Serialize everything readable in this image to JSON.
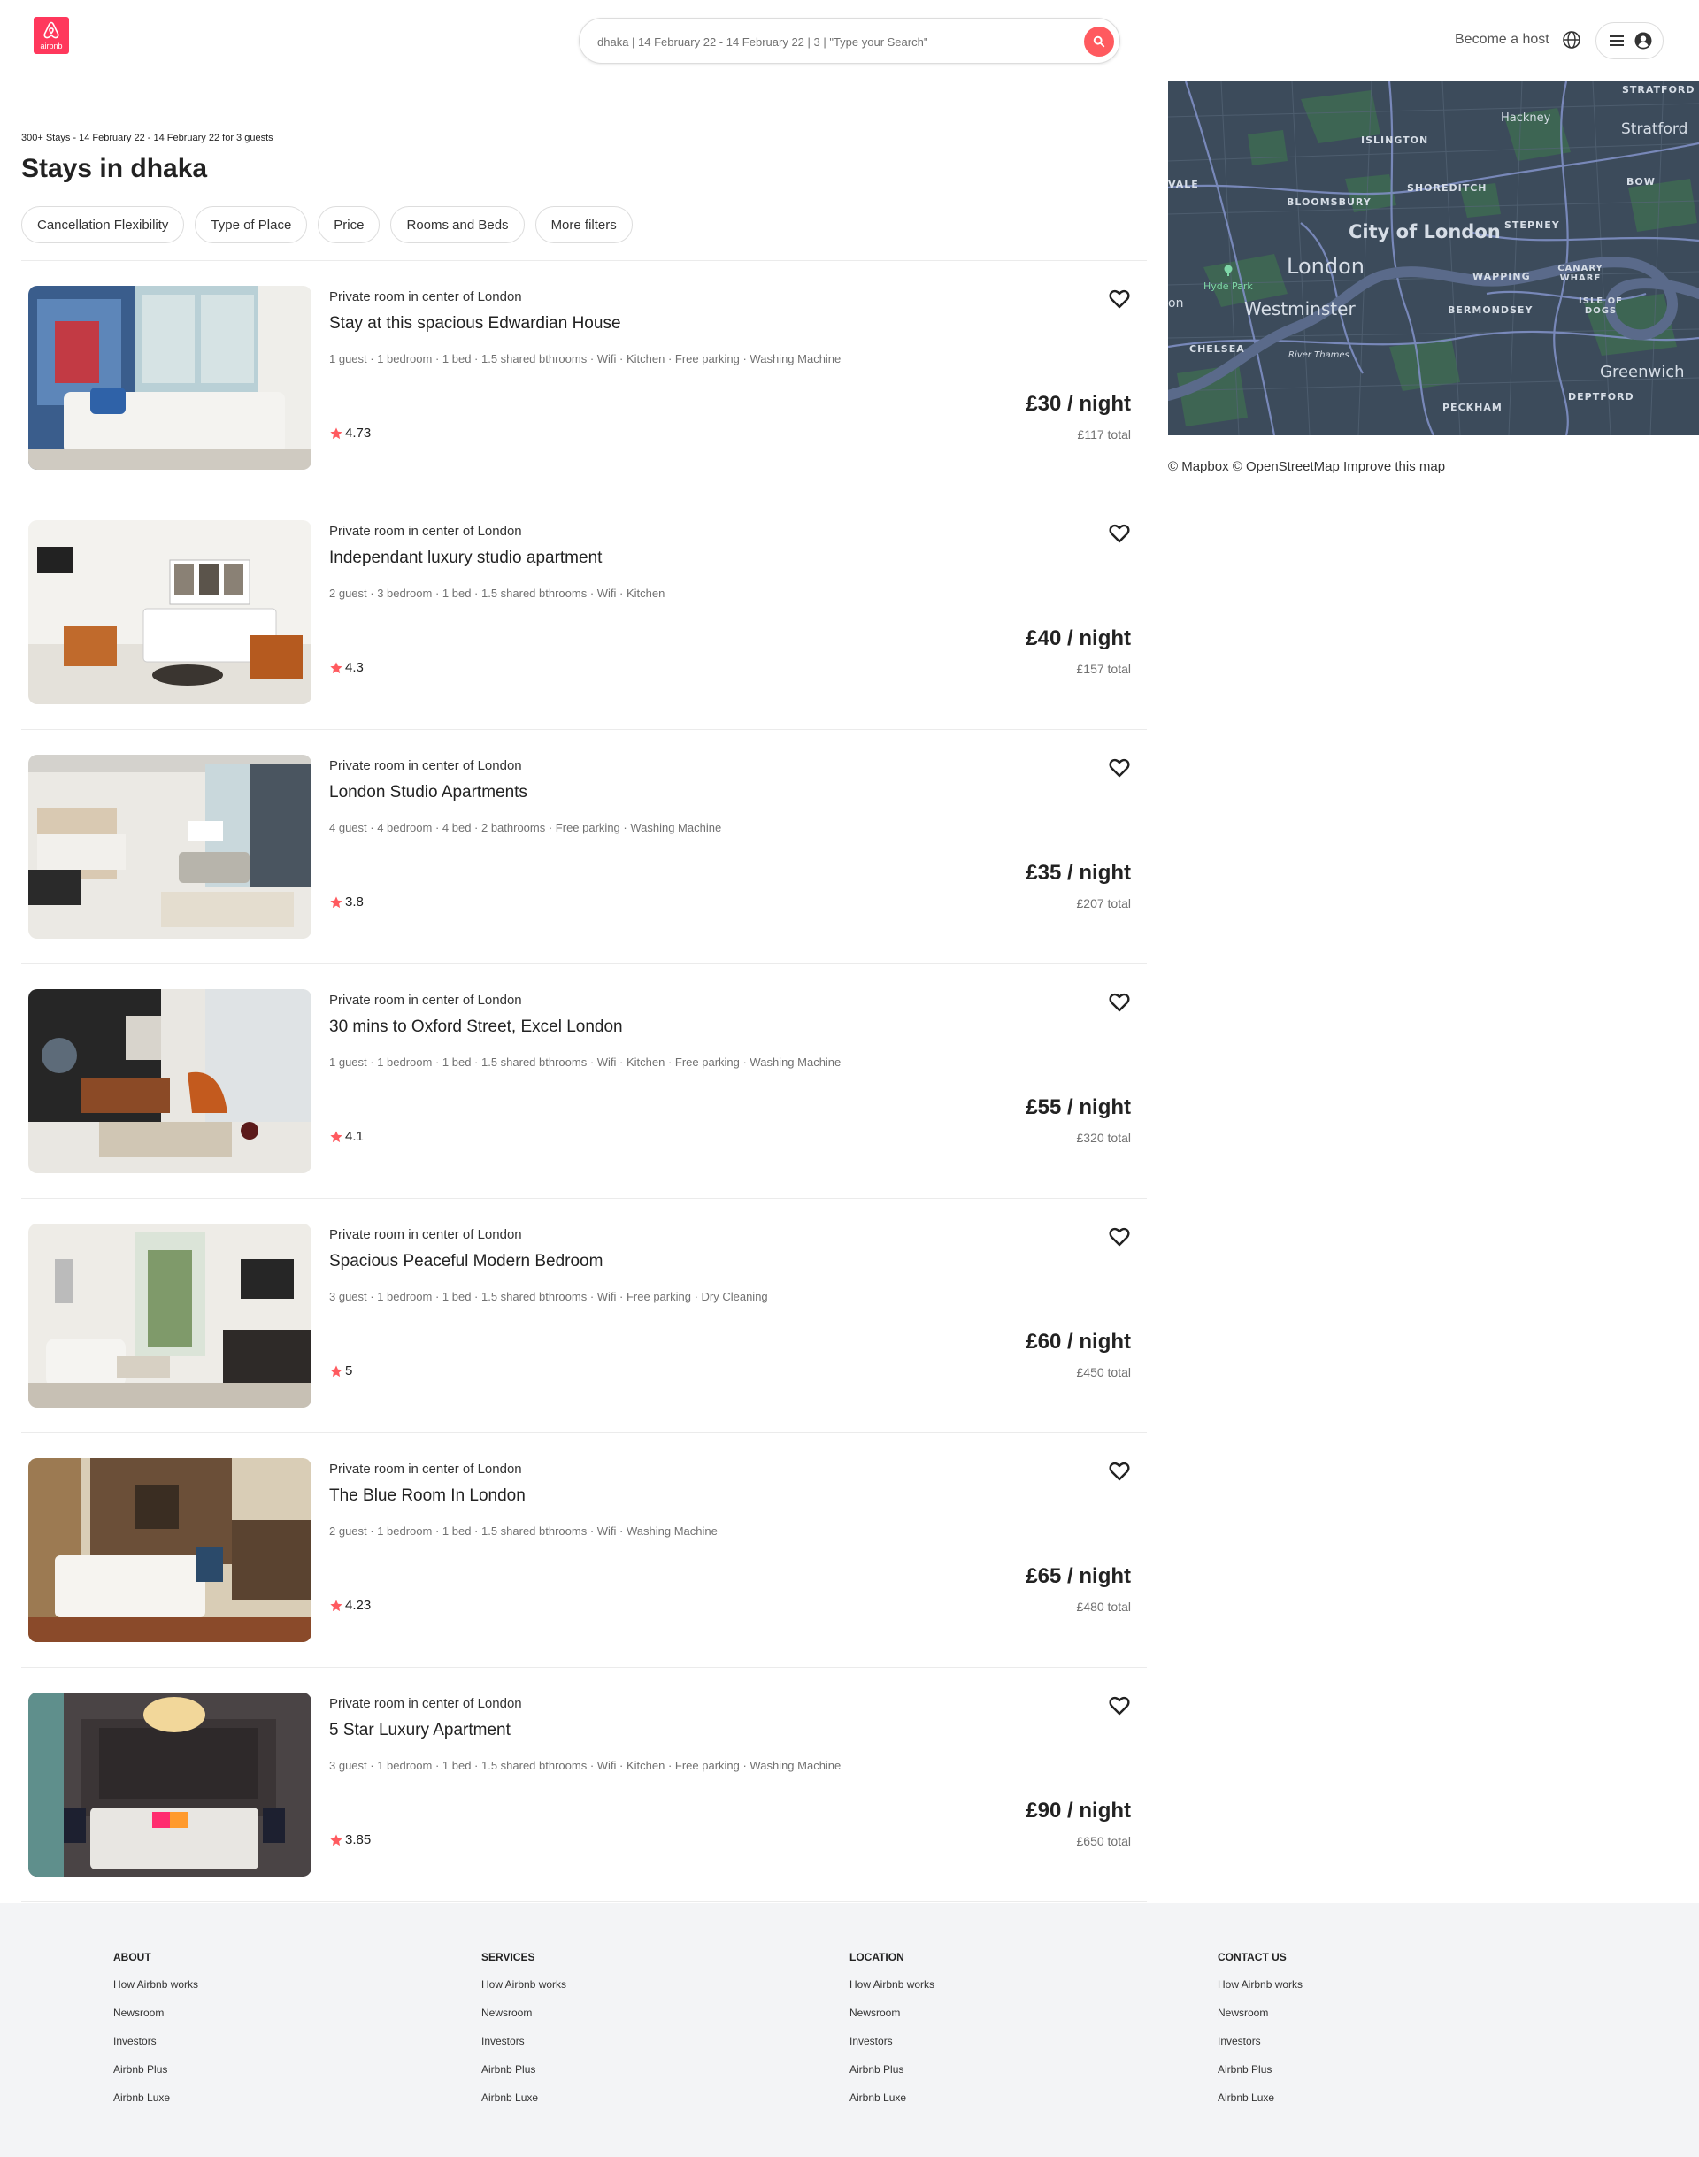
{
  "header": {
    "logo_text": "airbnb",
    "search_value": "dhaka | 14 February 22 - 14 February 22 | 3 | \"Type your Search\"",
    "become_host": "Become a host"
  },
  "map": {
    "labels": [
      "STRATFORD",
      "Stratford",
      "Hackney",
      "ISLINGTON",
      "VALE",
      "SHOREDITCH",
      "BOW",
      "BLOOMSBURY",
      "STEPNEY",
      "City of London",
      "London",
      "Hyde Park",
      "CANARY WHARF",
      "WAPPING",
      "ISLE OF DOGS",
      "on",
      "Westminster",
      "BERMONDSEY",
      "CHELSEA",
      "River Thames",
      "Greenwich",
      "DEPTFORD",
      "PECKHAM"
    ],
    "credit": "© Mapbox © OpenStreetMap Improve this map"
  },
  "results": {
    "meta": "300+ Stays - 14 February 22 - 14 February 22 for 3 guests",
    "title": "Stays in dhaka"
  },
  "filters": [
    "Cancellation Flexibility",
    "Type of Place",
    "Price",
    "Rooms and Beds",
    "More filters"
  ],
  "listings": [
    {
      "subtitle": "Private room in center of London",
      "title": "Stay at this spacious Edwardian House",
      "amenities": "1 guest · 1 bedroom · 1 bed · 1.5 shared bthrooms · Wifi · Kitchen · Free parking · Washing Machine",
      "rating": "4.73",
      "price": "£30 / night",
      "total": "£117 total"
    },
    {
      "subtitle": "Private room in center of London",
      "title": "Independant luxury studio apartment",
      "amenities": "2 guest · 3 bedroom · 1 bed · 1.5 shared bthrooms · Wifi · Kitchen",
      "rating": "4.3",
      "price": "£40 / night",
      "total": "£157 total"
    },
    {
      "subtitle": "Private room in center of London",
      "title": "London Studio Apartments",
      "amenities": "4 guest · 4 bedroom · 4 bed · 2 bathrooms · Free parking · Washing Machine",
      "rating": "3.8",
      "price": "£35 / night",
      "total": "£207 total"
    },
    {
      "subtitle": "Private room in center of London",
      "title": "30 mins to Oxford Street, Excel London",
      "amenities": "1 guest · 1 bedroom · 1 bed · 1.5 shared bthrooms · Wifi · Kitchen · Free parking · Washing Machine",
      "rating": "4.1",
      "price": "£55 / night",
      "total": "£320 total"
    },
    {
      "subtitle": "Private room in center of London",
      "title": "Spacious Peaceful Modern Bedroom",
      "amenities": "3 guest · 1 bedroom · 1 bed · 1.5 shared bthrooms · Wifi · Free parking · Dry Cleaning",
      "rating": "5",
      "price": "£60 / night",
      "total": "£450 total"
    },
    {
      "subtitle": "Private room in center of London",
      "title": "The Blue Room In London",
      "amenities": "2 guest · 1 bedroom · 1 bed · 1.5 shared bthrooms · Wifi · Washing Machine",
      "rating": "4.23",
      "price": "£65 / night",
      "total": "£480 total"
    },
    {
      "subtitle": "Private room in center of London",
      "title": "5 Star Luxury Apartment",
      "amenities": "3 guest · 1 bedroom · 1 bed · 1.5 shared bthrooms · Wifi · Kitchen · Free parking · Washing Machine",
      "rating": "3.85",
      "price": "£90 / night",
      "total": "£650 total"
    }
  ],
  "footer": {
    "columns": [
      {
        "heading": "ABOUT",
        "links": [
          "How Airbnb works",
          "Newsroom",
          "Investors",
          "Airbnb Plus",
          "Airbnb Luxe"
        ]
      },
      {
        "heading": "SERVICES",
        "links": [
          "How Airbnb works",
          "Newsroom",
          "Investors",
          "Airbnb Plus",
          "Airbnb Luxe"
        ]
      },
      {
        "heading": "LOCATION",
        "links": [
          "How Airbnb works",
          "Newsroom",
          "Investors",
          "Airbnb Plus",
          "Airbnb Luxe"
        ]
      },
      {
        "heading": "CONTACT US",
        "links": [
          "How Airbnb works",
          "Newsroom",
          "Investors",
          "Airbnb Plus",
          "Airbnb Luxe"
        ]
      }
    ]
  },
  "colors": {
    "brand": "#ff385c",
    "search_button": "#ff5a5f",
    "star": "#ff5a5f",
    "map_background": "#3b4a5a",
    "footer_background": "#f3f4f6"
  },
  "icons": [
    "airbnb-logo-icon",
    "search-icon",
    "globe-icon",
    "menu-icon",
    "user-icon",
    "heart-icon",
    "star-icon",
    "tree-icon"
  ]
}
